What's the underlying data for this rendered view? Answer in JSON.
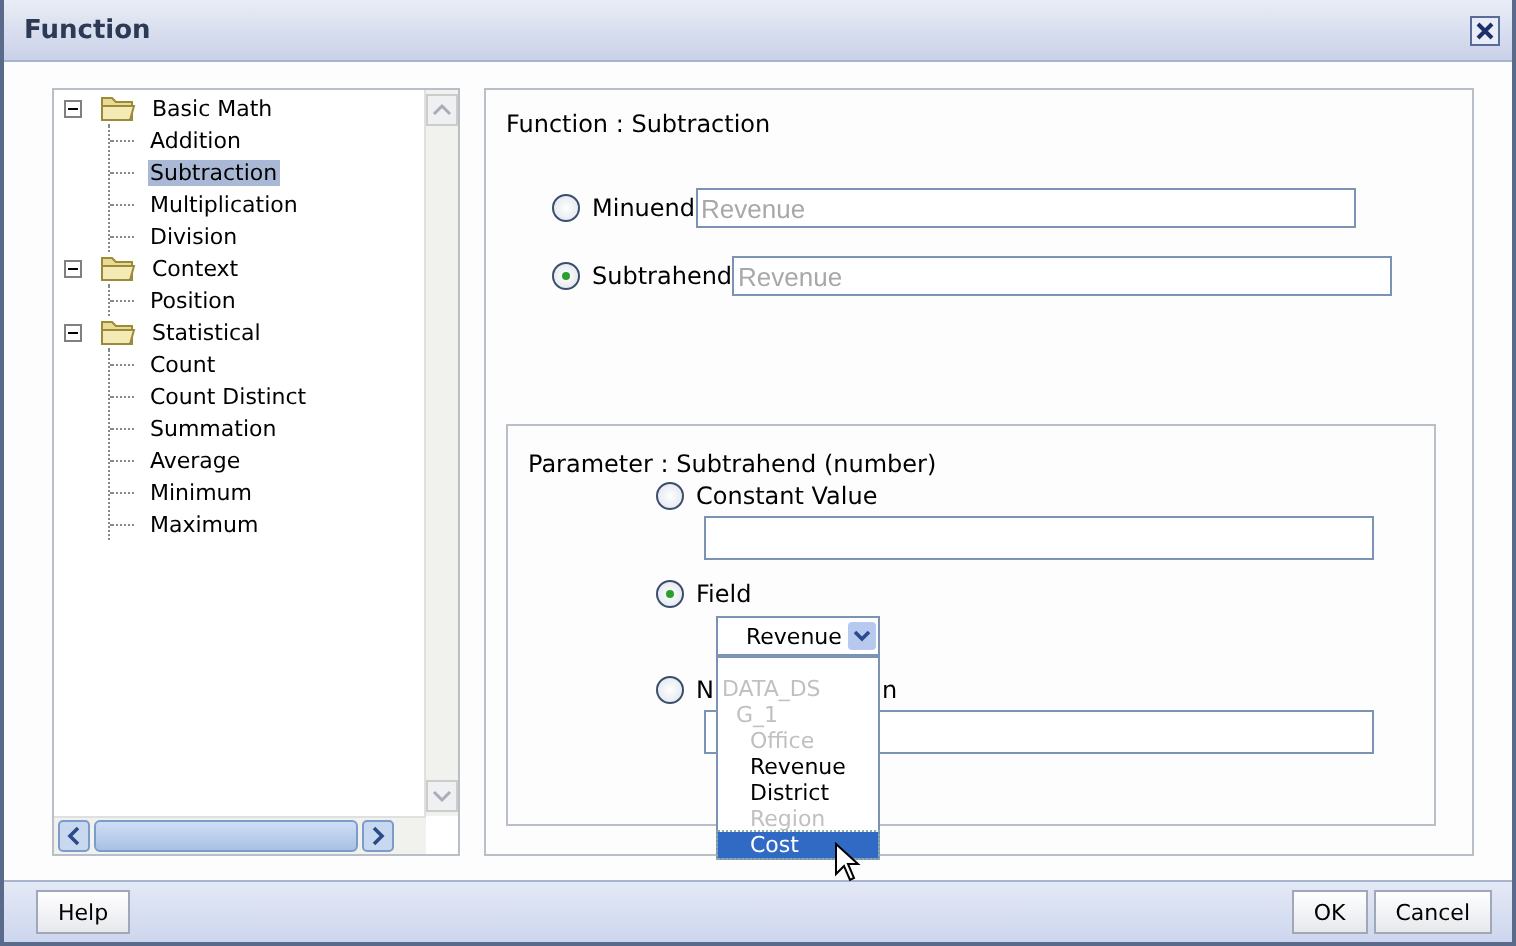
{
  "window": {
    "title": "Function"
  },
  "tree": [
    {
      "label": "Basic Math",
      "expanded": true,
      "children": [
        {
          "label": "Addition",
          "selected": false
        },
        {
          "label": "Subtraction",
          "selected": true
        },
        {
          "label": "Multiplication",
          "selected": false
        },
        {
          "label": "Division",
          "selected": false
        }
      ]
    },
    {
      "label": "Context",
      "expanded": true,
      "children": [
        {
          "label": "Position",
          "selected": false
        }
      ]
    },
    {
      "label": "Statistical",
      "expanded": true,
      "children": [
        {
          "label": "Count",
          "selected": false
        },
        {
          "label": "Count Distinct",
          "selected": false
        },
        {
          "label": "Summation",
          "selected": false
        },
        {
          "label": "Average",
          "selected": false
        },
        {
          "label": "Minimum",
          "selected": false
        },
        {
          "label": "Maximum",
          "selected": false
        }
      ]
    }
  ],
  "function_heading": "Function : Subtraction",
  "arguments": [
    {
      "label": "Minuend",
      "placeholder": "Revenue",
      "selected": false
    },
    {
      "label": "Subtrahend",
      "placeholder": "Revenue",
      "selected": true
    }
  ],
  "parameter": {
    "heading": "Parameter : Subtrahend (number)",
    "options": [
      {
        "kind": "text",
        "label": "Constant Value",
        "selected": false
      },
      {
        "kind": "select",
        "label": "Field",
        "selected": true,
        "value": "Revenue"
      },
      {
        "kind": "text",
        "label": "N",
        "label_tail": "n",
        "selected": false
      }
    ]
  },
  "dropdown_list": [
    {
      "label": "DATA_DS",
      "disabled": true,
      "selected": false,
      "children": [
        {
          "label": "G_1",
          "disabled": true,
          "selected": false,
          "children": [
            {
              "label": "Office",
              "disabled": true,
              "selected": false
            },
            {
              "label": "Revenue",
              "disabled": false,
              "selected": false
            },
            {
              "label": "District",
              "disabled": false,
              "selected": false
            },
            {
              "label": "Region",
              "disabled": true,
              "selected": false
            },
            {
              "label": "Cost",
              "disabled": false,
              "selected": true
            }
          ]
        }
      ]
    }
  ],
  "buttons_left": [
    "Help"
  ],
  "buttons_right": [
    "OK",
    "Cancel"
  ]
}
